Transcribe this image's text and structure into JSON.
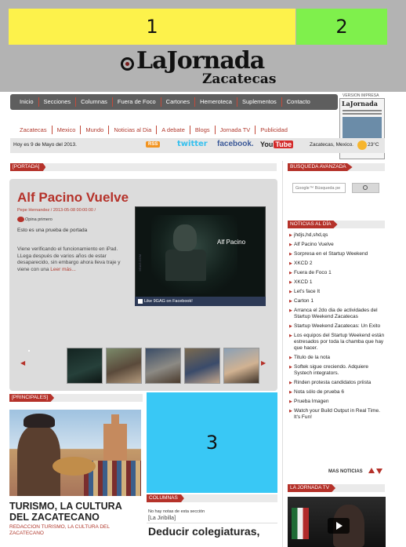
{
  "ads": {
    "slot1": "1",
    "slot2": "2",
    "slot3": "3"
  },
  "logo": {
    "brand": "LaJornada",
    "city": "Zacatecas"
  },
  "print_version_label": "VERSION IMPRESA",
  "print_thumb_title": "LaJornada",
  "nav_primary": [
    "Inicio",
    "Secciones",
    "Columnas",
    "Fuera de Foco",
    "Cartones",
    "Hemeroteca",
    "Suplementos",
    "Contacto"
  ],
  "nav_secondary": [
    "Zacatecas",
    "Mexico",
    "Mundo",
    "Noticias al Dia",
    "A debate",
    "Blogs",
    "Jornada TV",
    "Publicidad"
  ],
  "datebar": {
    "date": "Hoy es 9 de Mayo del 2013.",
    "rss": "RSS",
    "twitter": "twitter",
    "facebook": "facebook.",
    "youtube_left": "You",
    "youtube_right": "Tube",
    "weather_location": "Zacatecas, Mexico.",
    "temperature": "23°C"
  },
  "portada": {
    "label": "[PORTADA]",
    "headline": "Alf Pacino Vuelve",
    "byline": "Pepe Hernandez   /   2013-05-08 00:00:00   /",
    "opina": "Opina primero",
    "summary": "Esto es una prueba de portada",
    "body": "Viene verificando el funcionamiento en iPad. LLega después de varios años de estar desaparecido, sin embargo ahora lleva traje y viene con una",
    "read_more": "Leer más...",
    "image_caption": "Alf Pacino",
    "image_side_text": "9GAG.COM",
    "facebook_bar": "Like 9GAG on Facebook!"
  },
  "principales": {
    "label": "[PRINCIPALES]",
    "title": "TURISMO, LA CULTURA DEL ZACATECANO",
    "subtitle": "REDACCION TURISMO, LA CULTURA DEL ZACATECANO"
  },
  "columnas": {
    "label": "COLUMNAS",
    "no_notes": "No hay notas de esta sección",
    "section": "[La Jiribilla]",
    "headline": "Deducir colegiaturas,"
  },
  "busqueda": {
    "label": "BUSQUEDA AVANZADA",
    "placeholder": "Google™ Búsqueda pe"
  },
  "noticias": {
    "label": "NOTICIAS AL DÍA",
    "items": [
      "jhdjs,hd,shd,qs",
      "Alf Pacino Vuelve",
      "Sorpresa en el Startup Weekend",
      "XKCD 2",
      "Fuera de Foco 1",
      "XKCD 1",
      "Let's face It",
      "Carton 1",
      "Arranca el 2do dia de actividades del Startup Weekend Zacatecas",
      "Startup Weekend Zacatecas: Un Exito",
      "Los equipos del Startup Weekend están estresados por toda la chamba que hay que hacer.",
      "Titulo de la nota",
      "Softek sigue creciendo. Adquiere Systech integrators.",
      "Rinden protesta candidatos priista",
      "Nota sólo de prueba 6",
      "Prueba Imagen",
      "Watch your Build Output in Real Time. It's Fun!"
    ],
    "more": "MAS NOTICIAS"
  },
  "jornada_tv": {
    "label": "LA JORNADA TV"
  }
}
